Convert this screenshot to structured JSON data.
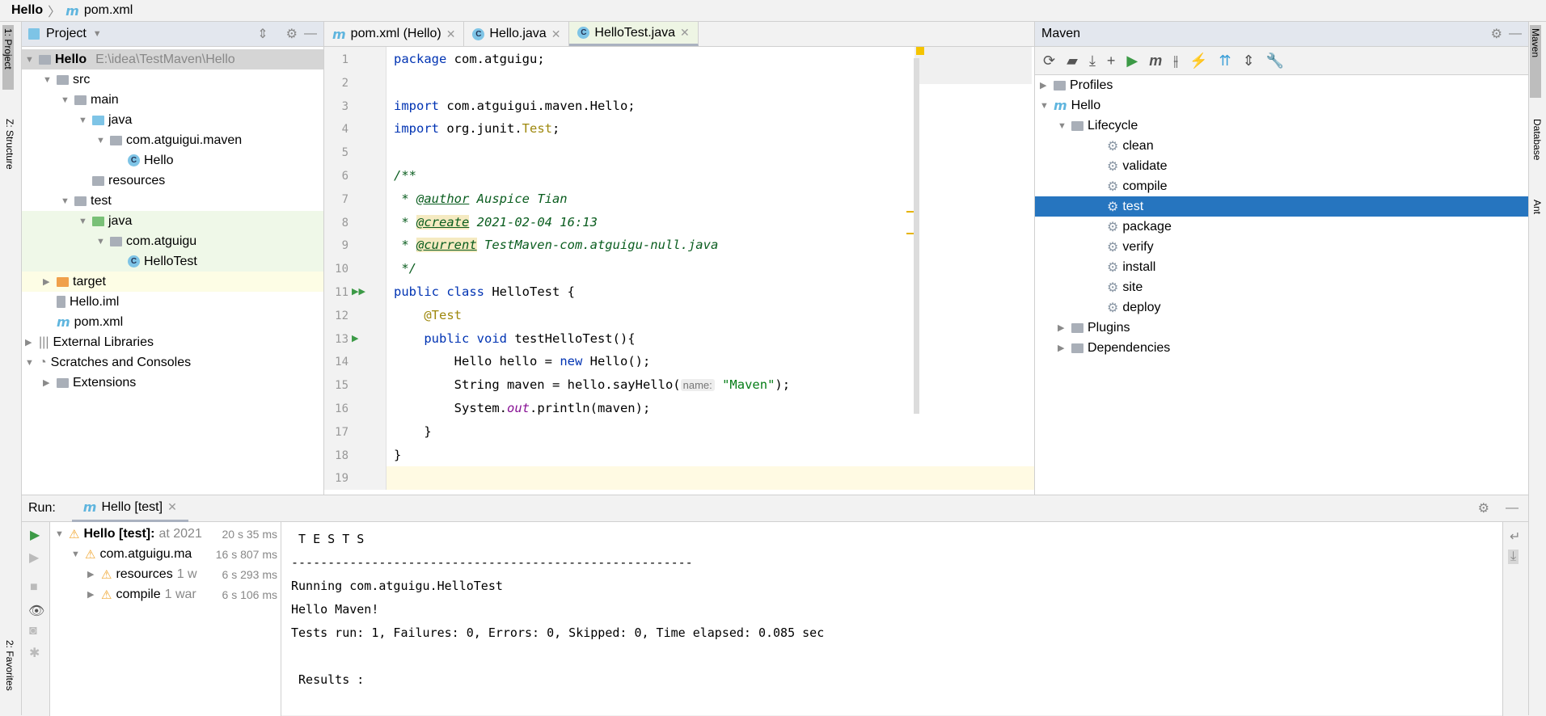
{
  "titlebar": {
    "project": "Hello",
    "file": "pom.xml"
  },
  "left_strip": {
    "project": "1: Project",
    "structure": "Z: Structure",
    "favorites": "2: Favorites"
  },
  "right_strip": {
    "maven": "Maven",
    "database": "Database",
    "ant": "Ant"
  },
  "project": {
    "title": "Project",
    "tree": [
      {
        "label": "Hello",
        "path": "E:\\idea\\TestMaven\\Hello",
        "depth": 0,
        "icon": "module-folder",
        "open": true,
        "selected": true
      },
      {
        "label": "src",
        "depth": 1,
        "icon": "folder",
        "open": true
      },
      {
        "label": "main",
        "depth": 2,
        "icon": "folder",
        "open": true
      },
      {
        "label": "java",
        "depth": 3,
        "icon": "source-folder",
        "open": true
      },
      {
        "label": "com.atguigui.maven",
        "depth": 4,
        "icon": "package",
        "open": true
      },
      {
        "label": "Hello",
        "depth": 5,
        "icon": "class"
      },
      {
        "label": "resources",
        "depth": 3,
        "icon": "resources-folder"
      },
      {
        "label": "test",
        "depth": 2,
        "icon": "folder",
        "open": true
      },
      {
        "label": "java",
        "depth": 3,
        "icon": "test-folder",
        "open": true,
        "hl": "green"
      },
      {
        "label": "com.atguigu",
        "depth": 4,
        "icon": "package",
        "open": true,
        "hl": "green"
      },
      {
        "label": "HelloTest",
        "depth": 5,
        "icon": "test-class",
        "hl": "green"
      },
      {
        "label": "target",
        "depth": 1,
        "icon": "excluded-folder",
        "closed": true,
        "hl": "yellow"
      },
      {
        "label": "Hello.iml",
        "depth": 1,
        "icon": "iml-file"
      },
      {
        "label": "pom.xml",
        "depth": 1,
        "icon": "maven-file"
      },
      {
        "label": "External Libraries",
        "depth": 0,
        "icon": "libraries",
        "closed": true
      },
      {
        "label": "Scratches and Consoles",
        "depth": 0,
        "icon": "scratches",
        "open": true
      },
      {
        "label": "Extensions",
        "depth": 1,
        "icon": "folder",
        "closed": true
      }
    ]
  },
  "editor": {
    "tabs": [
      {
        "label": "pom.xml (Hello)",
        "icon": "maven"
      },
      {
        "label": "Hello.java",
        "icon": "class"
      },
      {
        "label": "HelloTest.java",
        "icon": "test-class",
        "active": true
      }
    ],
    "lines": [
      [
        [
          "kw",
          "package"
        ],
        [
          "",
          "com.atguigu;"
        ]
      ],
      [],
      [
        [
          "kw",
          "import"
        ],
        [
          "",
          "com.atguigui.maven.Hello;"
        ]
      ],
      [
        [
          "kw",
          "import"
        ],
        [
          "",
          "org.junit."
        ],
        [
          "ann",
          "Test"
        ],
        [
          "",
          ";"
        ]
      ],
      [],
      [
        [
          "cm",
          "/**"
        ]
      ],
      [
        [
          "cm",
          " * "
        ],
        [
          "cmt",
          "@author"
        ],
        [
          "cm",
          " Auspice Tian"
        ]
      ],
      [
        [
          "cm",
          " * "
        ],
        [
          "cmt",
          "@create"
        ],
        [
          "cm",
          " 2021-02-04 16:13"
        ]
      ],
      [
        [
          "cm",
          " * "
        ],
        [
          "cmt",
          "@current"
        ],
        [
          "cm",
          " TestMaven-com.atguigu-null.java"
        ]
      ],
      [
        [
          "cm",
          " */"
        ]
      ],
      [
        [
          "kw",
          "public class"
        ],
        [
          "",
          "HelloTest {"
        ]
      ],
      [
        [
          "ann",
          "    @Test"
        ]
      ],
      [
        [
          "kw",
          "    public void"
        ],
        [
          "",
          "testHelloTest(){"
        ]
      ],
      [
        [
          "",
          "        Hello hello = "
        ],
        [
          "kw",
          "new"
        ],
        [
          "",
          "Hello();"
        ]
      ],
      [
        [
          "",
          "        String maven = hello.sayHello("
        ],
        [
          "hint",
          "name:"
        ],
        [
          "str",
          "\"Maven\""
        ],
        [
          "",
          ");"
        ]
      ],
      [
        [
          "",
          "        System."
        ],
        [
          "fld",
          "out"
        ],
        [
          "",
          ".println(maven);"
        ]
      ],
      [
        [
          "",
          "    }"
        ]
      ],
      [
        [
          "",
          "}"
        ]
      ],
      []
    ]
  },
  "maven": {
    "title": "Maven",
    "toolbar": [
      "reload-icon",
      "add-folder-icon",
      "download-icon",
      "plus-icon",
      "run-icon",
      "maven-goal-icon",
      "toggle-offline-icon",
      "skip-tests-icon",
      "show-deps-icon",
      "collapse-icon",
      "settings-wrench-icon"
    ],
    "tree": [
      {
        "label": "Profiles",
        "depth": 0,
        "closed": true
      },
      {
        "label": "Hello",
        "depth": 0,
        "open": true
      },
      {
        "label": "Lifecycle",
        "depth": 1,
        "open": true
      },
      {
        "label": "clean",
        "depth": 2,
        "goal": true
      },
      {
        "label": "validate",
        "depth": 2,
        "goal": true
      },
      {
        "label": "compile",
        "depth": 2,
        "goal": true
      },
      {
        "label": "test",
        "depth": 2,
        "goal": true,
        "selected": true
      },
      {
        "label": "package",
        "depth": 2,
        "goal": true
      },
      {
        "label": "verify",
        "depth": 2,
        "goal": true
      },
      {
        "label": "install",
        "depth": 2,
        "goal": true
      },
      {
        "label": "site",
        "depth": 2,
        "goal": true
      },
      {
        "label": "deploy",
        "depth": 2,
        "goal": true
      },
      {
        "label": "Plugins",
        "depth": 1,
        "closed": true
      },
      {
        "label": "Dependencies",
        "depth": 1,
        "closed": true
      }
    ],
    "selected_color": "#2675bf"
  },
  "run": {
    "label": "Run:",
    "tab": "Hello [test]",
    "tree": [
      {
        "label": "Hello [test]:",
        "extra": "at 2021",
        "time": "20 s 35 ms",
        "depth": 0,
        "bold": true
      },
      {
        "label": "com.atguigu.ma",
        "extra": "",
        "time": "16 s 807 ms",
        "depth": 1
      },
      {
        "label": "resources",
        "extra": "1 w",
        "time": "6 s 293 ms",
        "depth": 2
      },
      {
        "label": "compile",
        "extra": "1 war",
        "time": "6 s 106 ms",
        "depth": 2
      }
    ],
    "console": [
      " T E S T S",
      "-------------------------------------------------------",
      "Running com.atguigu.HelloTest",
      "Hello Maven!",
      "Tests run: 1, Failures: 0, Errors: 0, Skipped: 0, Time elapsed: 0.085 sec",
      "",
      " Results :"
    ]
  }
}
